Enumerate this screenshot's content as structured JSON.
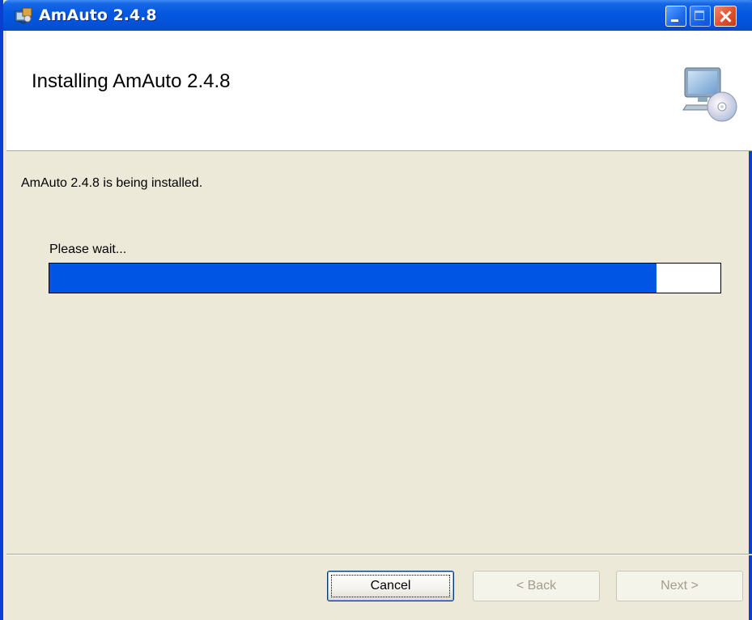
{
  "window": {
    "title": "AmAuto 2.4.8"
  },
  "header": {
    "title": "Installing AmAuto 2.4.8",
    "icon": "computer-cd-icon"
  },
  "body": {
    "status": "AmAuto 2.4.8 is being installed.",
    "wait_label": "Please wait...",
    "progress_fraction": 0.905
  },
  "buttons": {
    "cancel": "Cancel",
    "back": "< Back",
    "next": "Next >"
  },
  "colors": {
    "titlebar": "#0458e0",
    "progress_fill": "#0055e5",
    "dialog_bg": "#ece9d8"
  }
}
